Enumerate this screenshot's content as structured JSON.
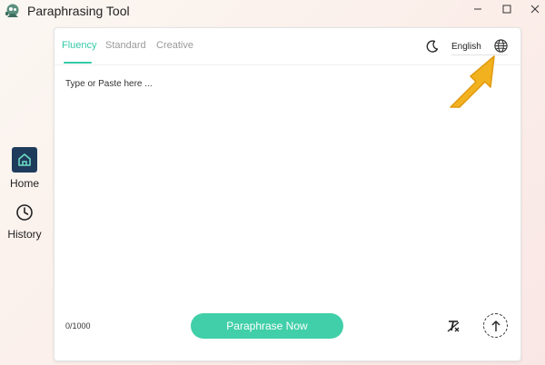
{
  "window": {
    "title": "Paraphrasing Tool",
    "controls": [
      "minimize",
      "maximize",
      "close"
    ]
  },
  "sidebar": {
    "items": [
      {
        "label": "Home",
        "icon": "home-icon",
        "active": true
      },
      {
        "label": "History",
        "icon": "clock-icon",
        "active": false
      }
    ]
  },
  "tabs": [
    {
      "label": "Fluency",
      "active": true
    },
    {
      "label": "Standard",
      "active": false
    },
    {
      "label": "Creative",
      "active": false
    }
  ],
  "toolbar": {
    "theme_icon": "moon-icon",
    "language": "English",
    "language_icon": "globe-icon"
  },
  "editor": {
    "placeholder": "Type or Paste here ...",
    "value": ""
  },
  "footer": {
    "char_count": "0/1000",
    "paraphrase_label": "Paraphrase Now",
    "clear_icon": "clear-format-icon",
    "upload_icon": "upload-icon"
  },
  "colors": {
    "accent": "#36c9a8",
    "button": "#40cfa8",
    "home_box": "#1f3b5c",
    "annotation_arrow": "#f2b11f"
  }
}
